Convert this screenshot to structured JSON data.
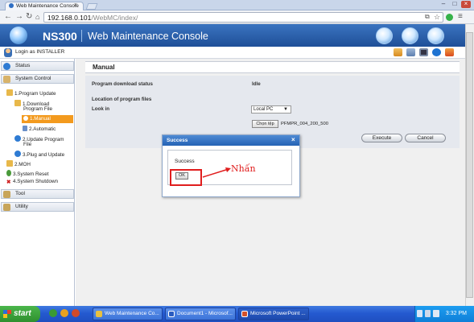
{
  "browser": {
    "tab_title": "Web Maintenance Console",
    "url_host": "192.168.0.101",
    "url_path": "/WebMC/index/"
  },
  "app": {
    "product": "NS300",
    "title": "Web Maintenance Console",
    "login_text": "Login as INSTALLER"
  },
  "sidebar": {
    "status": "Status",
    "system_control": "System Control",
    "program_update": "1.Program Update",
    "download_line1": "1.Download",
    "download_line2": "Program File",
    "manual": "1.Manual",
    "automatic": "2.Automatic",
    "update_line1": "2.Update Program",
    "update_line2": "File",
    "plug_update": "3.Plug and Update",
    "moh": "2.MOH",
    "system_reset": "3.System Reset",
    "system_shutdown": "4.System Shutdown",
    "tool": "Tool",
    "utility": "Utility"
  },
  "main": {
    "panel_title": "Manual",
    "status_label": "Program download status",
    "status_value": "Idle",
    "location_label": "Location of program files",
    "lookin_label": "Look in",
    "lookin_value": "Local PC",
    "choose_button": "Chọn tệp",
    "file_name": "PFMPR_004_200_500",
    "execute_button": "Execute",
    "cancel_button": "Cancel"
  },
  "dialog": {
    "title": "Success",
    "message": "Success",
    "ok_button": "OK"
  },
  "annotation": "Nhấn",
  "taskbar": {
    "start": "start",
    "tasks": [
      "Web Maintenance Co...",
      "Document1 - Microsof...",
      "Microsoft PowerPoint ..."
    ],
    "clock": "3:32 PM"
  },
  "colors": {
    "header_blue": "#1f4f98",
    "selected_orange": "#f39a1e",
    "annotation_red": "#e01d1d",
    "taskbar_blue": "#245ad0"
  }
}
